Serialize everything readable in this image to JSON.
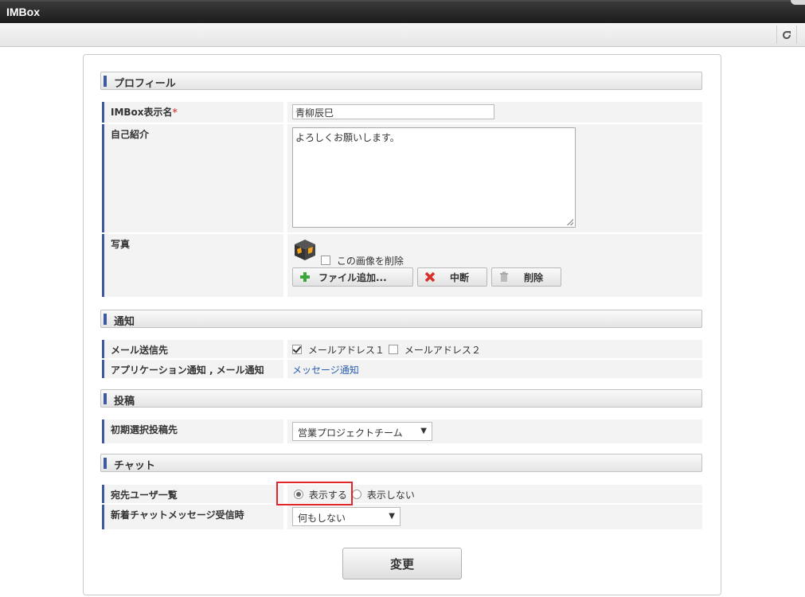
{
  "app": {
    "title": "IMBox"
  },
  "sections": {
    "profile": "プロフィール",
    "notification": "通知",
    "post": "投稿",
    "chat": "チャット"
  },
  "profile": {
    "display_name_label": "IMBox表示名",
    "required_mark": "*",
    "display_name_value": "青柳辰巳",
    "intro_label": "自己紹介",
    "intro_value": "よろしくお願いします。",
    "photo_label": "写真",
    "delete_image_label": "この画像を削除",
    "add_file_button": "ファイル追加...",
    "abort_button": "中断",
    "delete_button": "削除"
  },
  "notification": {
    "mail_dest_label": "メール送信先",
    "mail_address_1": "メールアドレス１",
    "mail_address_1_checked": true,
    "mail_address_2": "メールアドレス２",
    "mail_address_2_checked": false,
    "app_mail_label": "アプリケーション通知 , メール通知",
    "app_mail_link": "メッセージ通知"
  },
  "post": {
    "initial_target_label": "初期選択投稿先",
    "initial_target_value": "営業プロジェクトチーム"
  },
  "chat": {
    "dest_user_list_label": "宛先ユーザ一覧",
    "show_option": "表示する",
    "hide_option": "表示しない",
    "selected": "表示する",
    "new_message_label": "新着チャットメッセージ受信時",
    "new_message_value": "何もしない"
  },
  "submit_label": "変更",
  "colors": {
    "accent_bar": "#3d5a9e",
    "highlight": "#e0262a",
    "link": "#2a5db0"
  }
}
